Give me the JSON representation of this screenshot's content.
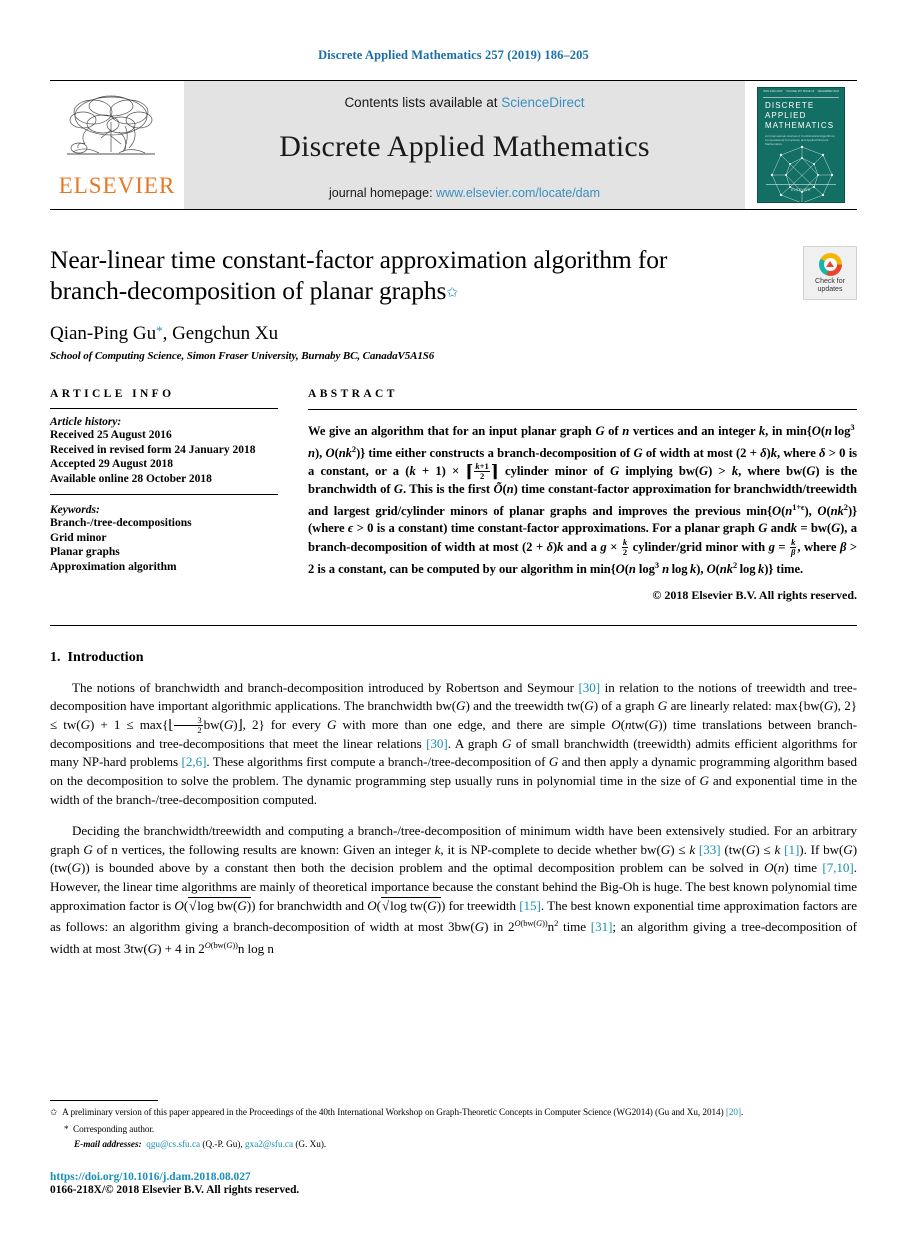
{
  "running_head": "Discrete Applied Mathematics 257 (2019) 186–205",
  "masthead": {
    "contents_prefix": "Contents lists available at ",
    "sciencedirect": "ScienceDirect",
    "journal_name": "Discrete Applied Mathematics",
    "homepage_prefix": "journal homepage: ",
    "homepage_url": "www.elsevier.com/locate/dam",
    "publisher_logo": "ELSEVIER",
    "cover": {
      "title_line1": "DISCRETE",
      "title_line2": "APPLIED",
      "title_line3": "MATHEMATICS",
      "subtitle": "An International Journal of Combinatorial Algorithms, Computational Complexity and Applied Discrete Mathematics",
      "top_left": "ISSN 0166-218X",
      "top_mid": "VOLUME 257 ISSUE 15",
      "top_right": "DECEMBER 2018",
      "publisher": "ELSEVIER"
    }
  },
  "article": {
    "title": "Near-linear time constant-factor approximation algorithm for branch-decomposition of planar graphs",
    "title_footnote_mark": "✩",
    "authors": "Qian-Ping Gu",
    "authors_rest": ", Gengchun Xu",
    "corresponding_mark": "*",
    "affiliation": "School of Computing Science, Simon Fraser University, Burnaby BC, CanadaV5A1S6",
    "crossmark": {
      "line1": "Check for",
      "line2": "updates"
    }
  },
  "info": {
    "heading": "ARTICLE INFO",
    "history_label": "Article history:",
    "history": [
      "Received 25 August 2016",
      "Received in revised form 24 January 2018",
      "Accepted 29 August 2018",
      "Available online 28 October 2018"
    ],
    "keywords_label": "Keywords:",
    "keywords": [
      "Branch-/tree-decompositions",
      "Grid minor",
      "Planar graphs",
      "Approximation algorithm"
    ]
  },
  "abstract": {
    "heading": "ABSTRACT",
    "copyright": "© 2018 Elsevier B.V. All rights reserved."
  },
  "sections": {
    "intro_number": "1.",
    "intro_title": "Introduction"
  },
  "footnotes": {
    "star_note": "A preliminary version of this paper appeared in the Proceedings of the 40th International Workshop on Graph-Theoretic Concepts in Computer Science (WG2014) (Gu and Xu, 2014)",
    "star_note_cite": "[20]",
    "star_note_end": ".",
    "corresponding": "Corresponding author.",
    "email_label": "E-mail addresses:",
    "email1": "qgu@cs.sfu.ca",
    "email1_who": "(Q.-P. Gu),",
    "email2": "gxa2@sfu.ca",
    "email2_who": "(G. Xu)."
  },
  "footer": {
    "doi": "https://doi.org/10.1016/j.dam.2018.08.027",
    "issn": "0166-218X/© 2018 Elsevier B.V. All rights reserved."
  },
  "colors": {
    "link": "#1a8fb5",
    "journal_blue": "#1a6fa8",
    "elsevier_orange": "#E87722",
    "cover_teal": "#136e63"
  }
}
